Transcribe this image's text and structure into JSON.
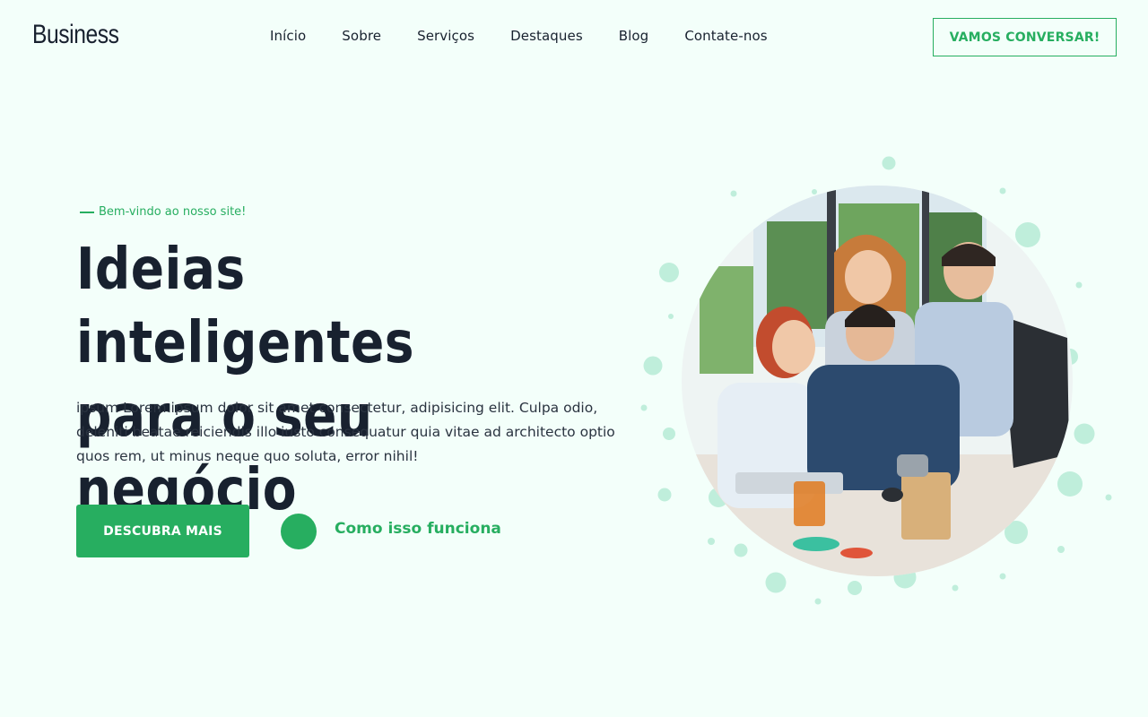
{
  "header": {
    "logo": "Business",
    "nav": [
      "Início",
      "Sobre",
      "Serviços",
      "Destaques",
      "Blog",
      "Contate-nos"
    ],
    "cta_label": "VAMOS CONVERSAR!"
  },
  "hero": {
    "eyebrow": "Bem-vindo ao nosso site!",
    "headline_line1": "Ideias inteligentes",
    "headline_line2": "para o seu negócio",
    "lead": "ipsum Lorem ipsum dolor sit amet consectetur, adipisicing elit. Culpa odio, deleniti beatae reiciendis illo iusto consequatur quia vitae ad architecto optio quos rem, ut minus neque quo soluta, error nihil!",
    "primary_button": "DESCUBRA MAIS",
    "secondary_link": "Como isso funciona",
    "image_icon": "team-photo"
  },
  "colors": {
    "accent": "#27ae60",
    "background": "#f3fffa",
    "text": "#18212f",
    "bubble": "#bfeedb"
  }
}
